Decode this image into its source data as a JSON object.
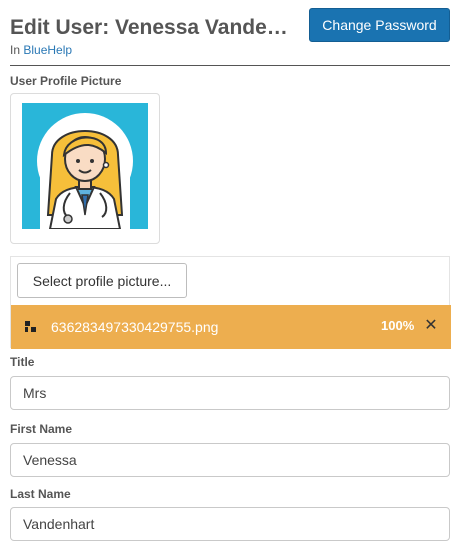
{
  "header": {
    "title": "Edit User: Venessa Vandenhart",
    "context_prefix": "In",
    "context_link": "BlueHelp",
    "change_password_label": "Change Password"
  },
  "profile_picture": {
    "label": "User Profile Picture",
    "select_button_label": "Select profile picture...",
    "file": {
      "name": "636283497330429755.png",
      "progress": "100%"
    }
  },
  "form": {
    "title": {
      "label": "Title",
      "value": "Mrs"
    },
    "first_name": {
      "label": "First Name",
      "value": "Venessa"
    },
    "last_name": {
      "label": "Last Name",
      "value": "Vandenhart"
    }
  },
  "colors": {
    "primary": "#1a73b1",
    "upload_bar": "#edae4f",
    "link": "#2a78b5"
  },
  "icons": [
    "doctor-avatar",
    "file-icon",
    "close-icon"
  ]
}
